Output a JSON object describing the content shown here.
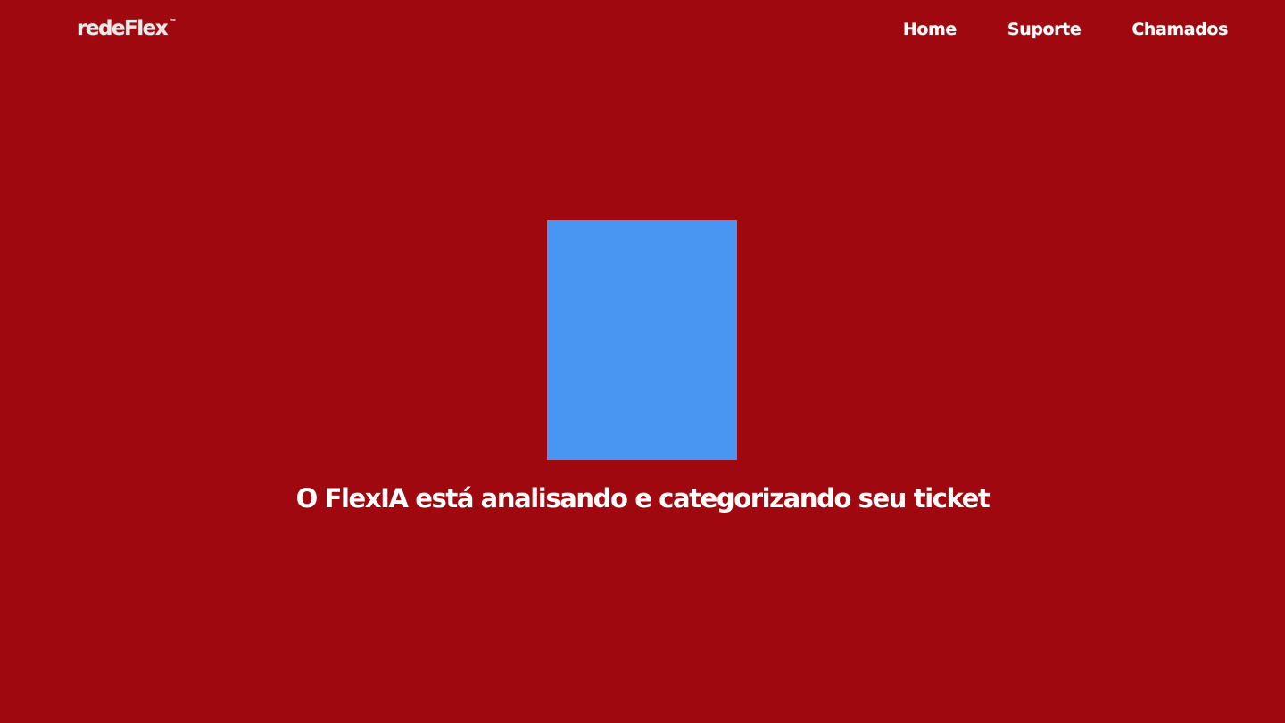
{
  "navbar": {
    "logo_text": "redeFlex",
    "logo_mark": "™",
    "links": [
      {
        "label": "Home"
      },
      {
        "label": "Suporte"
      },
      {
        "label": "Chamados"
      }
    ]
  },
  "main": {
    "loading_animation": "loading-animation-placeholder",
    "status_message": "O FlexIA está analisando e categorizando seu ticket"
  },
  "colors": {
    "background": "#9e080e",
    "loader_placeholder": "#4896f1",
    "text": "#ffffff"
  }
}
